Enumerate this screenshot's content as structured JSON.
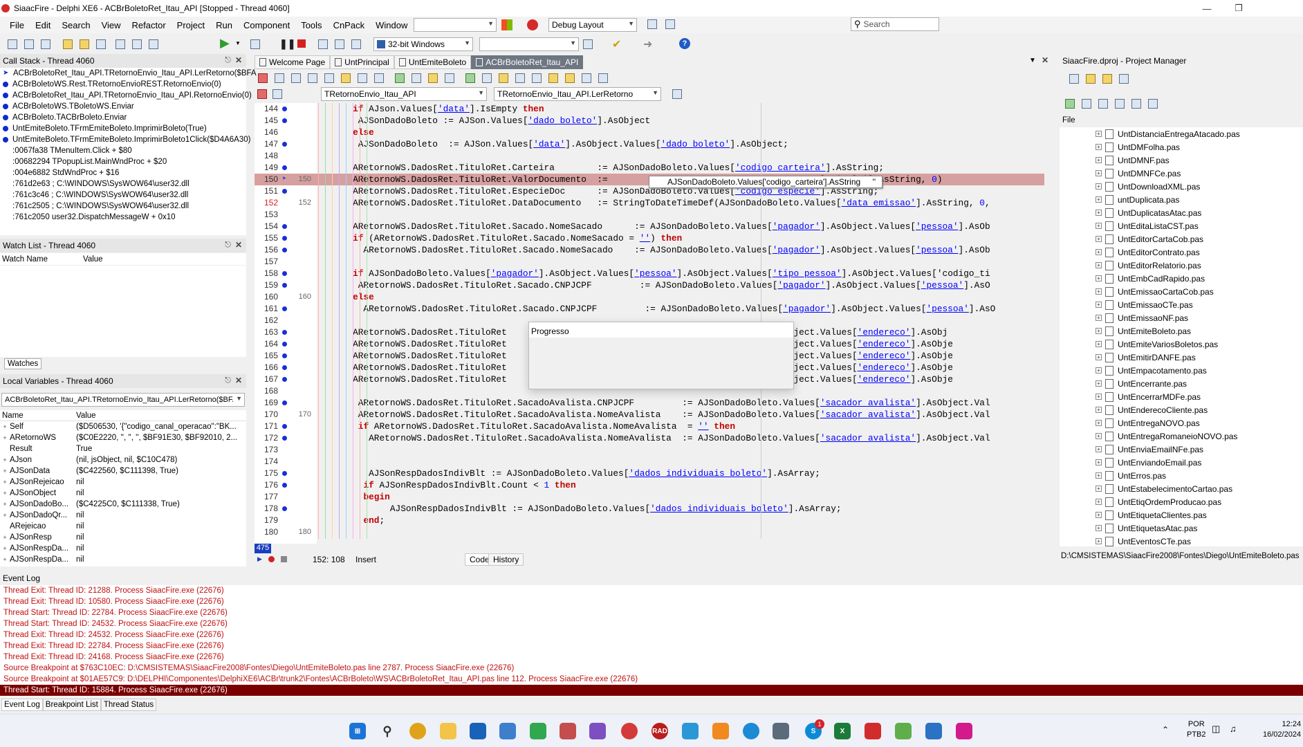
{
  "title": "SiaacFire - Delphi XE6 - ACBrBoletoRet_Itau_API [Stopped - Thread 4060]",
  "menu": [
    "File",
    "Edit",
    "Search",
    "View",
    "Refactor",
    "Project",
    "Run",
    "Component",
    "Tools",
    "CnPack",
    "Window",
    "Help"
  ],
  "layout_combo": "Debug Layout",
  "search_placeholder": "Search",
  "platform_combo": "32-bit Windows",
  "callstack": {
    "title": "Call Stack - Thread 4060",
    "items": [
      "ACBrBoletoRet_Itau_API.TRetornoEnvio_Itau_API.LerRetorno($BFA",
      "ACBrBoletoWS.Rest.TRetornoEnvioREST.RetornoEnvio(0)",
      "ACBrBoletoRet_Itau_API.TRetornoEnvio_Itau_API.RetornoEnvio(0)",
      "ACBrBoletoWS.TBoletoWS.Enviar",
      "ACBrBoleto.TACBrBoleto.Enviar",
      "UntEmiteBoleto.TFrmEmiteBoleto.ImprimirBoleto(True)",
      "UntEmiteBoleto.TFrmEmiteBoleto.ImprimirBoleto1Click($D4A6A30)",
      ":0067fa38 TMenuItem.Click + $80",
      ":00682294 TPopupList.MainWndProc + $20",
      ":004e6882 StdWndProc + $16",
      ":761d2e63 ; C:\\WINDOWS\\SysWOW64\\user32.dll",
      ":761c3c46 ; C:\\WINDOWS\\SysWOW64\\user32.dll",
      ":761c2505 ; C:\\WINDOWS\\SysWOW64\\user32.dll",
      ":761c2050 user32.DispatchMessageW + 0x10"
    ]
  },
  "watch": {
    "title": "Watch List - Thread 4060",
    "col_name": "Watch Name",
    "col_value": "Value",
    "tab": "Watches"
  },
  "locals": {
    "title": "Local Variables - Thread 4060",
    "combo": "ACBrBoletoRet_Itau_API.TRetornoEnvio_Itau_API.LerRetorno($BFA",
    "col_name": "Name",
    "col_value": "Value",
    "rows": [
      {
        "n": "Self",
        "v": "($D506530, '{\"codigo_canal_operacao\":\"BK..."
      },
      {
        "n": "ARetornoWS",
        "v": "($C0E2220, '', '', '', $BF91E30, $BF92010, 2..."
      },
      {
        "n": "Result",
        "v": "True"
      },
      {
        "n": "AJson",
        "v": "(nil, jsObject, nil, $C10C478)"
      },
      {
        "n": "AJSonData",
        "v": "($C422560, $C111398, True)"
      },
      {
        "n": "AJSonRejeicao",
        "v": "nil"
      },
      {
        "n": "AJSonObject",
        "v": "nil"
      },
      {
        "n": "AJSonDadoBo...",
        "v": "($C4225C0, $C111338, True)"
      },
      {
        "n": "AJSonDadoQr...",
        "v": "nil"
      },
      {
        "n": "ARejeicao",
        "v": "nil"
      },
      {
        "n": "AJSonResp",
        "v": "nil"
      },
      {
        "n": "AJSonRespDa...",
        "v": "nil"
      },
      {
        "n": "AJSonRespDa...",
        "v": "nil"
      }
    ]
  },
  "editor_tabs": [
    "Welcome Page",
    "UntPrincipal",
    "UntEmiteBoleto",
    "ACBrBoletoRet_Itau_API"
  ],
  "class_combo": "TRetornoEnvio_Itau_API",
  "method_combo": "TRetornoEnvio_Itau_API.LerRetorno",
  "code_lines": [
    {
      "ln": "144",
      "ln2": "",
      "bp": true,
      "t": "      if AJson.Values['data'].IsEmpty then"
    },
    {
      "ln": "145",
      "ln2": "",
      "bp": true,
      "t": "       AJSonDadoBoleto := AJSon.Values['dado_boleto'].AsObject"
    },
    {
      "ln": "146",
      "ln2": "",
      "bp": false,
      "t": "      else"
    },
    {
      "ln": "147",
      "ln2": "",
      "bp": true,
      "t": "       AJSonDadoBoleto  := AJSon.Values['data'].AsObject.Values['dado_boleto'].AsObject;"
    },
    {
      "ln": "148",
      "ln2": "",
      "bp": false,
      "t": ""
    },
    {
      "ln": "149",
      "ln2": "",
      "bp": true,
      "t": "      ARetornoWS.DadosRet.TituloRet.Carteira        := AJSonDadoBoleto.Values['codigo_carteira'].AsString;"
    },
    {
      "ln": "150",
      "ln2": "150",
      "bp": false,
      "t": "      ARetornoWS.DadosRet.TituloRet.ValorDocumento  :=                                  r_total_titulo'].AsString, 0)"
    },
    {
      "ln": "151",
      "ln2": "",
      "bp": true,
      "t": "      ARetornoWS.DadosRet.TituloRet.EspecieDoc      := AJSonDadoBoleto.Values['codigo_especie'].AsString;"
    },
    {
      "ln": "152",
      "ln2": "152",
      "bp": false,
      "t": "      ARetornoWS.DadosRet.TituloRet.DataDocumento   := StringToDateTimeDef(AJSonDadoBoleto.Values['data_emissao'].AsString, 0,"
    },
    {
      "ln": "153",
      "ln2": "",
      "bp": false,
      "t": ""
    },
    {
      "ln": "154",
      "ln2": "",
      "bp": true,
      "t": "      ARetornoWS.DadosRet.TituloRet.Sacado.NomeSacado      := AJSonDadoBoleto.Values['pagador'].AsObject.Values['pessoa'].AsOb"
    },
    {
      "ln": "155",
      "ln2": "",
      "bp": true,
      "t": "      if (ARetornoWS.DadosRet.TituloRet.Sacado.NomeSacado = '') then"
    },
    {
      "ln": "156",
      "ln2": "",
      "bp": true,
      "t": "        ARetornoWS.DadosRet.TituloRet.Sacado.NomeSacado    := AJSonDadoBoleto.Values['pagador'].AsObject.Values['pessoa'].AsOb"
    },
    {
      "ln": "157",
      "ln2": "",
      "bp": false,
      "t": ""
    },
    {
      "ln": "158",
      "ln2": "",
      "bp": true,
      "t": "      if AJSonDadoBoleto.Values['pagador'].AsObject.Values['pessoa'].AsObject.Values['tipo_pessoa'].AsObject.Values['codigo_ti"
    },
    {
      "ln": "159",
      "ln2": "",
      "bp": true,
      "t": "       ARetornoWS.DadosRet.TituloRet.Sacado.CNPJCPF         := AJSonDadoBoleto.Values['pagador'].AsObject.Values['pessoa'].AsO"
    },
    {
      "ln": "160",
      "ln2": "160",
      "bp": false,
      "t": "      else"
    },
    {
      "ln": "161",
      "ln2": "",
      "bp": true,
      "t": "        ARetornoWS.DadosRet.TituloRet.Sacado.CNPJCPF         := AJSonDadoBoleto.Values['pagador'].AsObject.Values['pessoa'].AsO"
    },
    {
      "ln": "162",
      "ln2": "",
      "bp": false,
      "t": ""
    },
    {
      "ln": "163",
      "ln2": "",
      "bp": true,
      "t": "      ARetornoWS.DadosRet.TituloRet                                       'pagador'].AsObject.Values['endereco'].AsObj"
    },
    {
      "ln": "164",
      "ln2": "",
      "bp": true,
      "t": "      ARetornoWS.DadosRet.TituloRet                                       'pagador'].AsObject.Values['endereco'].AsObje"
    },
    {
      "ln": "165",
      "ln2": "",
      "bp": true,
      "t": "      ARetornoWS.DadosRet.TituloRet                                       'pagador'].AsObject.Values['endereco'].AsObje"
    },
    {
      "ln": "166",
      "ln2": "",
      "bp": true,
      "t": "      ARetornoWS.DadosRet.TituloRet                                       'pagador'].AsObject.Values['endereco'].AsObje"
    },
    {
      "ln": "167",
      "ln2": "",
      "bp": true,
      "t": "      ARetornoWS.DadosRet.TituloRet                                       'pagador'].AsObject.Values['endereco'].AsObje"
    },
    {
      "ln": "168",
      "ln2": "",
      "bp": false,
      "t": ""
    },
    {
      "ln": "169",
      "ln2": "",
      "bp": true,
      "t": "       ARetornoWS.DadosRet.TituloRet.SacadoAvalista.CNPJCPF         := AJSonDadoBoleto.Values['sacador_avalista'].AsObject.Val"
    },
    {
      "ln": "170",
      "ln2": "170",
      "bp": false,
      "t": "       ARetornoWS.DadosRet.TituloRet.SacadoAvalista.NomeAvalista    := AJSonDadoBoleto.Values['sacador_avalista'].AsObject.Val"
    },
    {
      "ln": "171",
      "ln2": "",
      "bp": true,
      "t": "       if ARetornoWS.DadosRet.TituloRet.SacadoAvalista.NomeAvalista  = '' then"
    },
    {
      "ln": "172",
      "ln2": "",
      "bp": true,
      "t": "         ARetornoWS.DadosRet.TituloRet.SacadoAvalista.NomeAvalista  := AJSonDadoBoleto.Values['sacador_avalista'].AsObject.Val"
    },
    {
      "ln": "173",
      "ln2": "",
      "bp": false,
      "t": ""
    },
    {
      "ln": "174",
      "ln2": "",
      "bp": false,
      "t": ""
    },
    {
      "ln": "175",
      "ln2": "",
      "bp": true,
      "t": "         AJSonRespDadosIndivBlt := AJSonDadoBoleto.Values['dados_individuais_boleto'].AsArray;"
    },
    {
      "ln": "176",
      "ln2": "",
      "bp": true,
      "t": "        if AJSonRespDadosIndivBlt.Count < 1 then"
    },
    {
      "ln": "177",
      "ln2": "",
      "bp": false,
      "t": "        begin"
    },
    {
      "ln": "178",
      "ln2": "",
      "bp": true,
      "t": "             AJSonRespDadosIndivBlt := AJSonDadoBoleto.Values['dados_individuais_boleto'].AsArray;"
    },
    {
      "ln": "179",
      "ln2": "",
      "bp": false,
      "t": "        end;"
    },
    {
      "ln": "180",
      "ln2": "180",
      "bp": false,
      "t": ""
    }
  ],
  "tooltip": "AJSonDadoBoleto.Values['codigo_carteira'].AsString",
  "tooltip_val": "''",
  "progress_title": "Progresso",
  "status": {
    "pos": "152: 108",
    "mode": "Insert",
    "tab_code": "Code",
    "tab_history": "History",
    "line_box": "475"
  },
  "pm": {
    "title": "SiaacFire.dproj - Project Manager",
    "file_label": "File",
    "path": "D:\\CMSISTEMAS\\SiaacFire2008\\Fontes\\Diego\\UntEmiteBoleto.pas",
    "items": [
      "UntDistanciaEntregaAtacado.pas",
      "UntDMFolha.pas",
      "UntDMNF.pas",
      "UntDMNFCe.pas",
      "UntDownloadXML.pas",
      "untDuplicata.pas",
      "UntDuplicatasAtac.pas",
      "UntEditaListaCST.pas",
      "UntEditorCartaCob.pas",
      "UntEditorContrato.pas",
      "UntEditorRelatorio.pas",
      "UntEmbCadRapido.pas",
      "UntEmissaoCartaCob.pas",
      "UntEmissaoCTe.pas",
      "UntEmissaoNF.pas",
      "UntEmiteBoleto.pas",
      "UntEmiteVariosBoletos.pas",
      "UntEmitirDANFE.pas",
      "UntEmpacotamento.pas",
      "UntEncerrante.pas",
      "UntEncerrarMDFe.pas",
      "UntEnderecoCliente.pas",
      "UntEntregaNOVO.pas",
      "UntEntregaRomaneioNOVO.pas",
      "UntEnviaEmailNFe.pas",
      "UntEnviandoEmail.pas",
      "UntErros.pas",
      "UntEstabelecimentoCartao.pas",
      "UntEtiqOrdemProducao.pas",
      "UntEtiquetaClientes.pas",
      "UntEtiquetasAtac.pas",
      "UntEventosCTe.pas"
    ]
  },
  "eventlog": {
    "title": "Event Log",
    "lines": [
      "Thread Exit: Thread ID: 21288. Process SiaacFire.exe (22676)",
      "Thread Exit: Thread ID: 10580. Process SiaacFire.exe (22676)",
      "Thread Start: Thread ID: 22784. Process SiaacFire.exe (22676)",
      "Thread Start: Thread ID: 24532. Process SiaacFire.exe (22676)",
      "Thread Exit: Thread ID: 24532. Process SiaacFire.exe (22676)",
      "Thread Exit: Thread ID: 22784. Process SiaacFire.exe (22676)",
      "Thread Exit: Thread ID: 24168. Process SiaacFire.exe (22676)",
      "Source Breakpoint at $763C10EC: D:\\CMSISTEMAS\\SiaacFire2008\\Fontes\\Diego\\UntEmiteBoleto.pas line 2787. Process SiaacFire.exe (22676)",
      "Source Breakpoint at $01AE57C9: D:\\DELPHI\\Componentes\\DelphiXE6\\ACBr\\trunk2\\Fontes\\ACBrBoleto\\WS\\ACBrBoletoRet_Itau_API.pas line 112. Process SiaacFire.exe (22676)",
      "Thread Start: Thread ID: 15884. Process SiaacFire.exe (22676)"
    ],
    "tabs": [
      "Event Log",
      "Breakpoint List",
      "Thread Status"
    ]
  },
  "tray": {
    "lang": "POR",
    "layout": "PTB2",
    "time": "12:24",
    "date": "16/02/2024",
    "badge": "1"
  }
}
